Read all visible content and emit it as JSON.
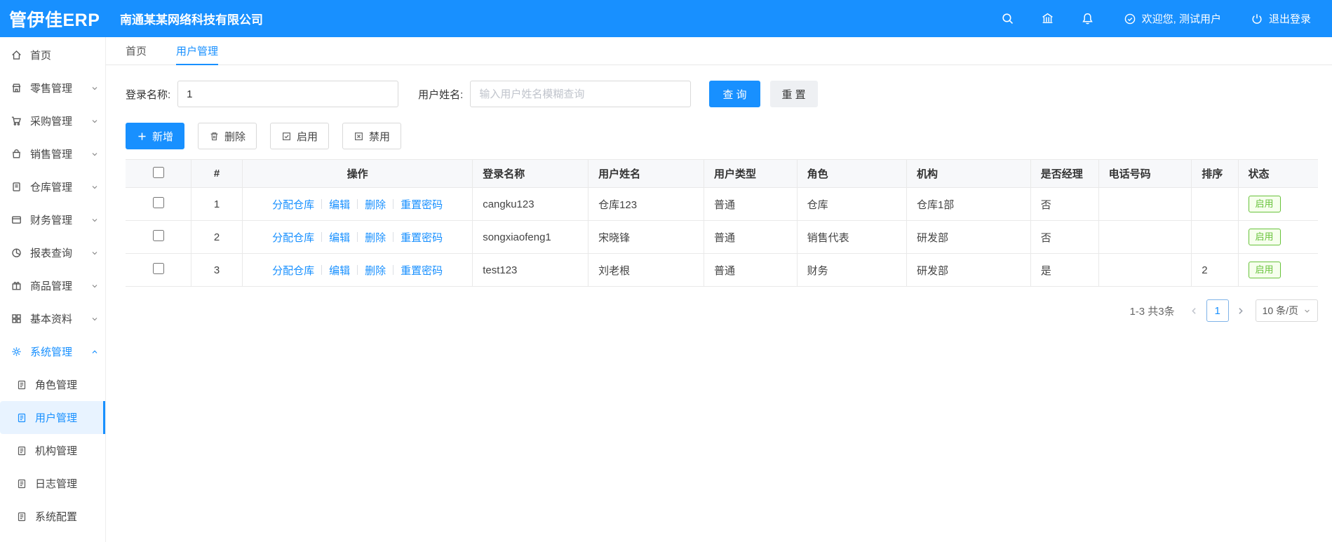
{
  "header": {
    "logo": "管伊佳ERP",
    "company": "南通某某网络科技有限公司",
    "welcome": "欢迎您, 测试用户",
    "logout": "退出登录"
  },
  "sidebar": {
    "items": [
      {
        "label": "首页"
      },
      {
        "label": "零售管理"
      },
      {
        "label": "采购管理"
      },
      {
        "label": "销售管理"
      },
      {
        "label": "仓库管理"
      },
      {
        "label": "财务管理"
      },
      {
        "label": "报表查询"
      },
      {
        "label": "商品管理"
      },
      {
        "label": "基本资料"
      },
      {
        "label": "系统管理"
      }
    ],
    "system_children": [
      {
        "label": "角色管理"
      },
      {
        "label": "用户管理"
      },
      {
        "label": "机构管理"
      },
      {
        "label": "日志管理"
      },
      {
        "label": "系统配置"
      }
    ]
  },
  "tabs": [
    {
      "label": "首页"
    },
    {
      "label": "用户管理"
    }
  ],
  "filters": {
    "login_name_label": "登录名称:",
    "login_name_value": "1",
    "user_name_label": "用户姓名:",
    "user_name_placeholder": "输入用户姓名模糊查询",
    "search_button": "查 询",
    "reset_button": "重 置"
  },
  "toolbar": {
    "add": "新增",
    "delete": "删除",
    "enable": "启用",
    "disable": "禁用"
  },
  "table": {
    "headers": {
      "index": "#",
      "actions": "操作",
      "login_name": "登录名称",
      "user_name": "用户姓名",
      "user_type": "用户类型",
      "role": "角色",
      "org": "机构",
      "is_manager": "是否经理",
      "phone": "电话号码",
      "sort": "排序",
      "status": "状态"
    },
    "action_links": [
      "分配仓库",
      "编辑",
      "删除",
      "重置密码"
    ],
    "rows": [
      {
        "index": "1",
        "login_name": "cangku123",
        "user_name": "仓库123",
        "user_type": "普通",
        "role": "仓库",
        "org": "仓库1部",
        "is_manager": "否",
        "phone": "",
        "sort": "",
        "status": "启用"
      },
      {
        "index": "2",
        "login_name": "songxiaofeng1",
        "user_name": "宋晓锋",
        "user_type": "普通",
        "role": "销售代表",
        "org": "研发部",
        "is_manager": "否",
        "phone": "",
        "sort": "",
        "status": "启用"
      },
      {
        "index": "3",
        "login_name": "test123",
        "user_name": "刘老根",
        "user_type": "普通",
        "role": "财务",
        "org": "研发部",
        "is_manager": "是",
        "phone": "",
        "sort": "2",
        "status": "启用"
      }
    ]
  },
  "pagination": {
    "total_text": "1-3 共3条",
    "current_page": "1",
    "page_size": "10 条/页"
  },
  "colors": {
    "primary": "#1890ff",
    "success": "#67c23a",
    "header_bg": "#1890ff"
  },
  "icons": [
    "search-icon",
    "bank-icon",
    "bell-icon",
    "user-circle-icon",
    "power-icon",
    "home-icon",
    "retail-icon",
    "purchase-cart-icon",
    "sales-bag-icon",
    "warehouse-book-icon",
    "finance-card-icon",
    "report-pie-icon",
    "product-gift-icon",
    "basic-grid-icon",
    "gear-icon",
    "document-icon",
    "plus-icon",
    "trash-icon",
    "check-square-icon",
    "x-square-icon",
    "chevron-down-icon",
    "chevron-up-icon",
    "chevron-left-icon",
    "chevron-right-icon"
  ]
}
